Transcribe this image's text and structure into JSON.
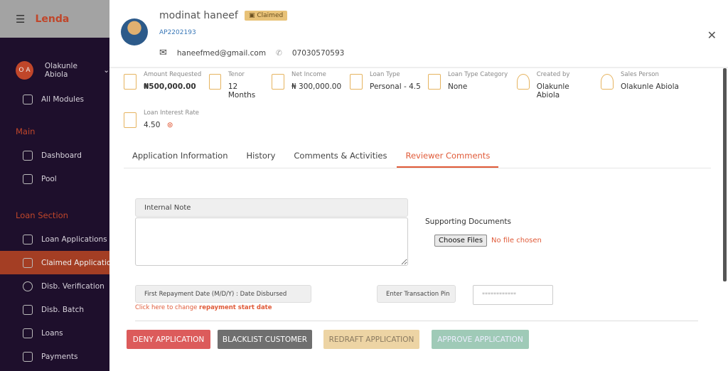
{
  "app": {
    "logo": "Lenda"
  },
  "sidebar": {
    "user_initials": "O A",
    "user_name": "Olakunle Abiola",
    "all_modules": "All Modules",
    "main_title": "Main",
    "main_items": [
      "Dashboard",
      "Pool"
    ],
    "loan_title": "Loan Section",
    "loan_items": [
      "Loan Applications",
      "Claimed Applications",
      "Disb. Verification",
      "Disb. Batch",
      "Loans",
      "Payments"
    ]
  },
  "customer": {
    "name": "modinat haneef",
    "status": "Claimed",
    "app_id": "AP2202193",
    "email": "haneefmed@gmail.com",
    "phone": "07030570593"
  },
  "fields": [
    {
      "label": "Amount Requested",
      "value": "₦500,000.00"
    },
    {
      "label": "Tenor",
      "value": "12 Months"
    },
    {
      "label": "Net Income",
      "value": "₦ 300,000.00"
    },
    {
      "label": "Loan Type",
      "value": "Personal - 4.5"
    },
    {
      "label": "Loan Type Category",
      "value": "None"
    },
    {
      "label": "Created by",
      "value": "Olakunle Abiola"
    },
    {
      "label": "Sales Person",
      "value": "Olakunle Abiola"
    },
    {
      "label": "Loan Interest Rate",
      "value": "4.50"
    }
  ],
  "tabs": [
    "Application Information",
    "History",
    "Comments & Activities",
    "Reviewer Comments"
  ],
  "form": {
    "internal_note": "Internal Note",
    "supporting_docs": "Supporting Documents",
    "choose_files": "Choose Files",
    "no_file": "No file chosen",
    "repayment_label": "First Repayment Date (M/D/Y) : Date Disbursed",
    "change_prefix": "Click here to change ",
    "change_link": "repayment start date",
    "pin_label": "Enter Transaction Pin",
    "pin_value": "************"
  },
  "actions": {
    "deny": "DENY APPLICATION",
    "blacklist": "BLACKLIST CUSTOMER",
    "redraft": "REDRAFT APPLICATION",
    "approve": "APPROVE APPLICATION"
  },
  "colors": {
    "accent": "#e05a38",
    "deny": "#dc5b5b",
    "blacklist": "#6f6f6f",
    "redraft": "#edd4a4",
    "approve": "#9fcab7"
  }
}
